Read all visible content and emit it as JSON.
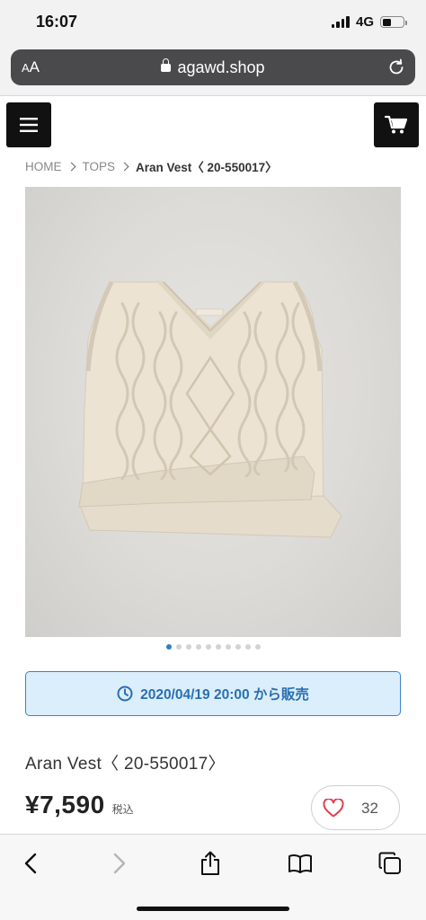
{
  "status_bar": {
    "time": "16:07",
    "network": "4G"
  },
  "browser": {
    "aa_label": "AA",
    "url": "agawd.shop"
  },
  "breadcrumb": {
    "home": "HOME",
    "category": "TOPS",
    "current": "Aran Vest〈 20-550017〉"
  },
  "carousel": {
    "slide_count": 10,
    "active_index": 0
  },
  "release": {
    "text": "2020/04/19 20:00 から販売"
  },
  "product": {
    "title": "Aran Vest〈 20-550017〉",
    "price": "¥7,590",
    "tax_label": "税込",
    "like_count": "32"
  },
  "colors": {
    "accent_blue": "#3b83c6",
    "banner_bg": "#dbeefb",
    "dark_button": "#111111",
    "heart_red": "#d9434f"
  },
  "icons": {
    "menu": "hamburger-icon",
    "cart": "cart-icon",
    "clock": "clock-icon",
    "heart": "heart-icon",
    "back": "chevron-left-icon",
    "forward": "chevron-right-icon",
    "share": "share-icon",
    "bookmarks": "book-icon",
    "tabs": "tabs-icon",
    "reload": "reload-icon",
    "lock": "lock-icon"
  }
}
